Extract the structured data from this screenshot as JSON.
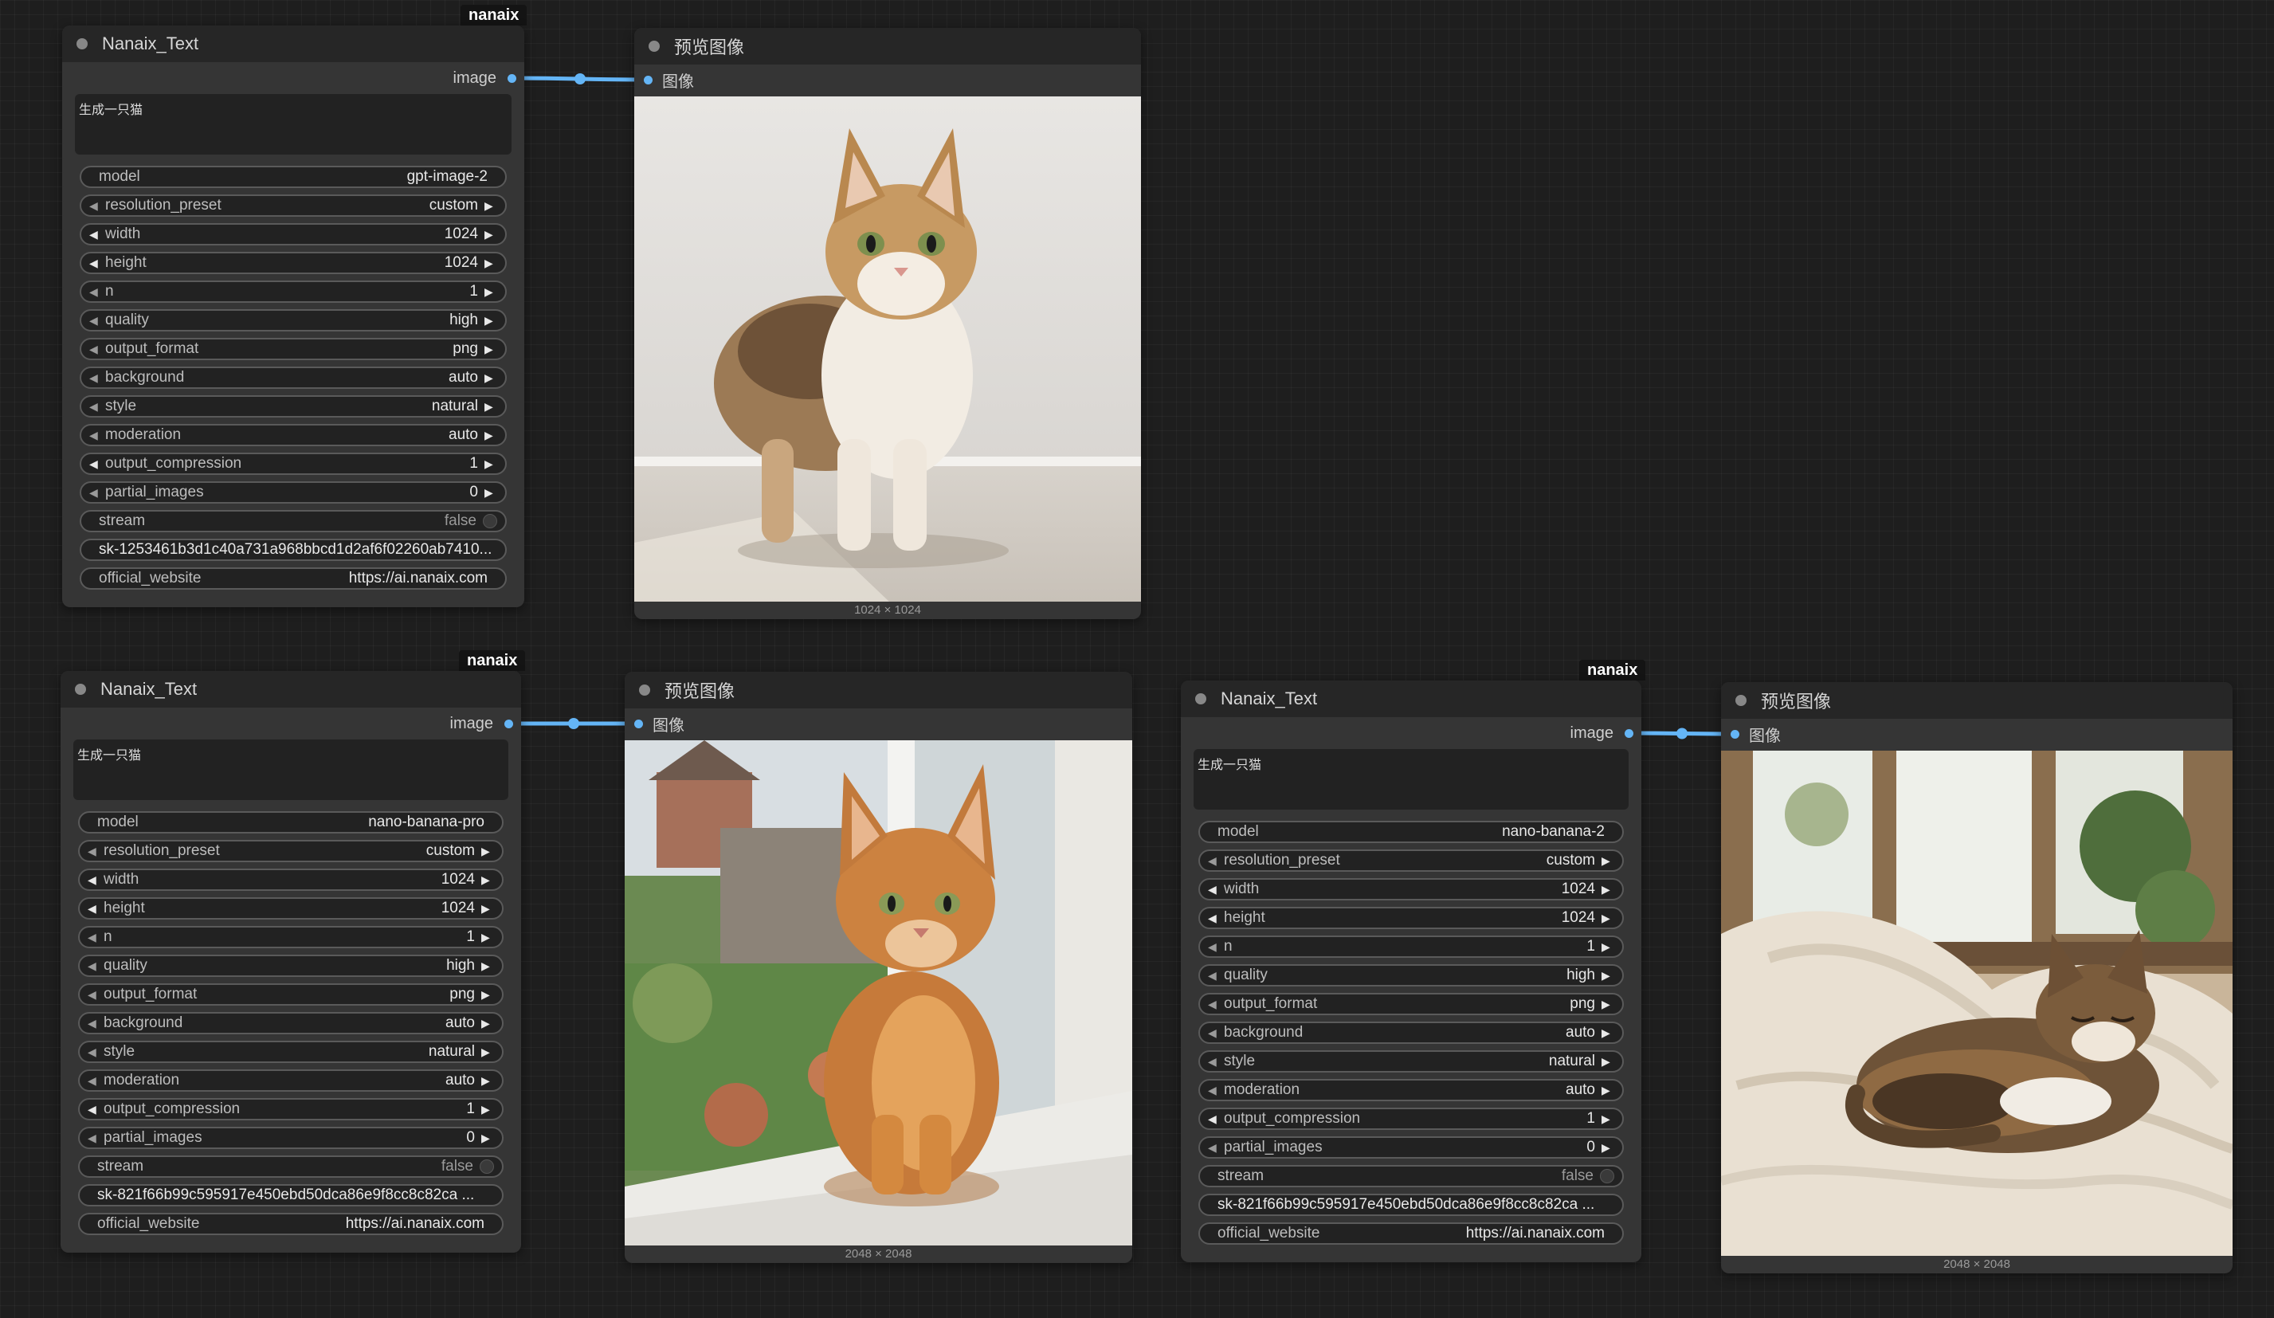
{
  "groups": [
    {
      "badge": "nanaix",
      "text_node": {
        "title": "Nanaix_Text",
        "output_label": "image",
        "prompt": "生成一只猫",
        "widgets": [
          {
            "name": "model",
            "value": "gpt-image-2",
            "type": "combo"
          },
          {
            "name": "resolution_preset",
            "value": "custom",
            "type": "combo_arrows"
          },
          {
            "name": "width",
            "value": "1024",
            "type": "number"
          },
          {
            "name": "height",
            "value": "1024",
            "type": "number"
          },
          {
            "name": "n",
            "value": "1",
            "type": "number_dim"
          },
          {
            "name": "quality",
            "value": "high",
            "type": "combo_arrows"
          },
          {
            "name": "output_format",
            "value": "png",
            "type": "combo_arrows"
          },
          {
            "name": "background",
            "value": "auto",
            "type": "combo_arrows"
          },
          {
            "name": "style",
            "value": "natural",
            "type": "combo_arrows"
          },
          {
            "name": "moderation",
            "value": "auto",
            "type": "combo_arrows"
          },
          {
            "name": "output_compression",
            "value": "1",
            "type": "number"
          },
          {
            "name": "partial_images",
            "value": "0",
            "type": "number_dim"
          },
          {
            "name": "stream",
            "value": "false",
            "type": "toggle"
          },
          {
            "name": "",
            "value": "sk-1253461b3d1c40a731a968bbcd1d2af6f02260ab7410...",
            "type": "text"
          },
          {
            "name": "official_website",
            "value": "https://ai.nanaix.com",
            "type": "plain"
          }
        ]
      },
      "preview_node": {
        "title": "预览图像",
        "input_label": "图像",
        "caption": "1024 × 1024",
        "scene": "standing-cat"
      }
    },
    {
      "badge": "nanaix",
      "text_node": {
        "title": "Nanaix_Text",
        "output_label": "image",
        "prompt": "生成一只猫",
        "widgets": [
          {
            "name": "model",
            "value": "nano-banana-pro",
            "type": "combo"
          },
          {
            "name": "resolution_preset",
            "value": "custom",
            "type": "combo_arrows"
          },
          {
            "name": "width",
            "value": "1024",
            "type": "number"
          },
          {
            "name": "height",
            "value": "1024",
            "type": "number"
          },
          {
            "name": "n",
            "value": "1",
            "type": "number_dim"
          },
          {
            "name": "quality",
            "value": "high",
            "type": "combo_arrows"
          },
          {
            "name": "output_format",
            "value": "png",
            "type": "combo_arrows"
          },
          {
            "name": "background",
            "value": "auto",
            "type": "combo_arrows"
          },
          {
            "name": "style",
            "value": "natural",
            "type": "combo_arrows"
          },
          {
            "name": "moderation",
            "value": "auto",
            "type": "combo_arrows"
          },
          {
            "name": "output_compression",
            "value": "1",
            "type": "number"
          },
          {
            "name": "partial_images",
            "value": "0",
            "type": "number_dim"
          },
          {
            "name": "stream",
            "value": "false",
            "type": "toggle"
          },
          {
            "name": "",
            "value": "sk-821f66b99c595917e450ebd50dca86e9f8cc8c82ca ...",
            "type": "text"
          },
          {
            "name": "official_website",
            "value": "https://ai.nanaix.com",
            "type": "plain"
          }
        ]
      },
      "preview_node": {
        "title": "预览图像",
        "input_label": "图像",
        "caption": "2048 × 2048",
        "scene": "window-cat"
      }
    },
    {
      "badge": "nanaix",
      "text_node": {
        "title": "Nanaix_Text",
        "output_label": "image",
        "prompt": "生成一只猫",
        "widgets": [
          {
            "name": "model",
            "value": "nano-banana-2",
            "type": "combo"
          },
          {
            "name": "resolution_preset",
            "value": "custom",
            "type": "combo_arrows"
          },
          {
            "name": "width",
            "value": "1024",
            "type": "number"
          },
          {
            "name": "height",
            "value": "1024",
            "type": "number"
          },
          {
            "name": "n",
            "value": "1",
            "type": "number_dim"
          },
          {
            "name": "quality",
            "value": "high",
            "type": "combo_arrows"
          },
          {
            "name": "output_format",
            "value": "png",
            "type": "combo_arrows"
          },
          {
            "name": "background",
            "value": "auto",
            "type": "combo_arrows"
          },
          {
            "name": "style",
            "value": "natural",
            "type": "combo_arrows"
          },
          {
            "name": "moderation",
            "value": "auto",
            "type": "combo_arrows"
          },
          {
            "name": "output_compression",
            "value": "1",
            "type": "number"
          },
          {
            "name": "partial_images",
            "value": "0",
            "type": "number_dim"
          },
          {
            "name": "stream",
            "value": "false",
            "type": "toggle"
          },
          {
            "name": "",
            "value": "sk-821f66b99c595917e450ebd50dca86e9f8cc8c82ca ...",
            "type": "text"
          },
          {
            "name": "official_website",
            "value": "https://ai.nanaix.com",
            "type": "plain"
          }
        ]
      },
      "preview_node": {
        "title": "预览图像",
        "input_label": "图像",
        "caption": "2048 × 2048",
        "scene": "blanket-cat"
      }
    }
  ],
  "colors": {
    "canvas_bg": "#1e1e1e",
    "node_bg": "#353535",
    "title_bg": "#262626",
    "link": "#64b5f6",
    "badge_bg": "#141414"
  }
}
